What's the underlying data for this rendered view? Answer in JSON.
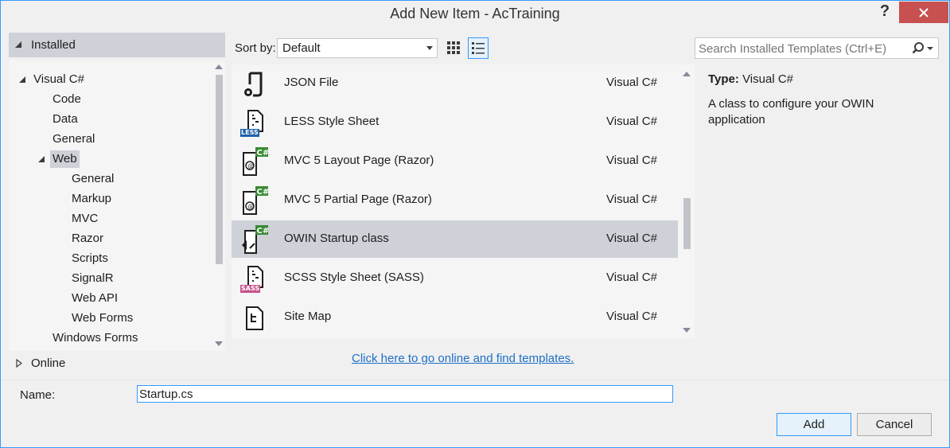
{
  "window": {
    "title": "Add New Item - AcTraining"
  },
  "titlebar": {
    "help_glyph": "?"
  },
  "left": {
    "installed_label": "Installed",
    "tree": [
      {
        "label": "Visual C#",
        "level": 1,
        "expanded": true
      },
      {
        "label": "Code",
        "level": 2
      },
      {
        "label": "Data",
        "level": 2
      },
      {
        "label": "General",
        "level": 2
      },
      {
        "label": "Web",
        "level": 2,
        "expanded": true,
        "selected": true
      },
      {
        "label": "General",
        "level": 3
      },
      {
        "label": "Markup",
        "level": 3
      },
      {
        "label": "MVC",
        "level": 3
      },
      {
        "label": "Razor",
        "level": 3
      },
      {
        "label": "Scripts",
        "level": 3
      },
      {
        "label": "SignalR",
        "level": 3
      },
      {
        "label": "Web API",
        "level": 3
      },
      {
        "label": "Web Forms",
        "level": 3
      },
      {
        "label": "Windows Forms",
        "level": 2
      }
    ],
    "online_label": "Online"
  },
  "toolbar": {
    "sort_label": "Sort by:",
    "sort_value": "Default",
    "search_placeholder": "Search Installed Templates (Ctrl+E)"
  },
  "templates": [
    {
      "name": "JSON File",
      "lang": "Visual C#",
      "icon": "json-file-icon"
    },
    {
      "name": "LESS Style Sheet",
      "lang": "Visual C#",
      "icon": "less-file-icon",
      "badge": "LESS",
      "badge_color": "#1f5fa8"
    },
    {
      "name": "MVC 5 Layout Page (Razor)",
      "lang": "Visual C#",
      "icon": "razor-layout-icon"
    },
    {
      "name": "MVC 5 Partial Page (Razor)",
      "lang": "Visual C#",
      "icon": "razor-partial-icon"
    },
    {
      "name": "OWIN Startup class",
      "lang": "Visual C#",
      "icon": "owin-class-icon",
      "selected": true
    },
    {
      "name": "SCSS Style Sheet (SASS)",
      "lang": "Visual C#",
      "icon": "sass-file-icon",
      "badge": "SASS",
      "badge_color": "#c6538c"
    },
    {
      "name": "Site Map",
      "lang": "Visual C#",
      "icon": "sitemap-icon"
    }
  ],
  "online_link": "Click here to go online and find templates.",
  "detail": {
    "type_label": "Type:",
    "type_value": "Visual C#",
    "description": "A class to configure your OWIN application"
  },
  "name_field": {
    "label": "Name:",
    "value": "Startup.cs"
  },
  "buttons": {
    "add": "Add",
    "cancel": "Cancel"
  },
  "colors": {
    "selection": "#cfd1d8",
    "accent": "#3399ff",
    "close": "#c75050",
    "csharp_badge": "#388a34",
    "link": "#1e6fc6"
  }
}
